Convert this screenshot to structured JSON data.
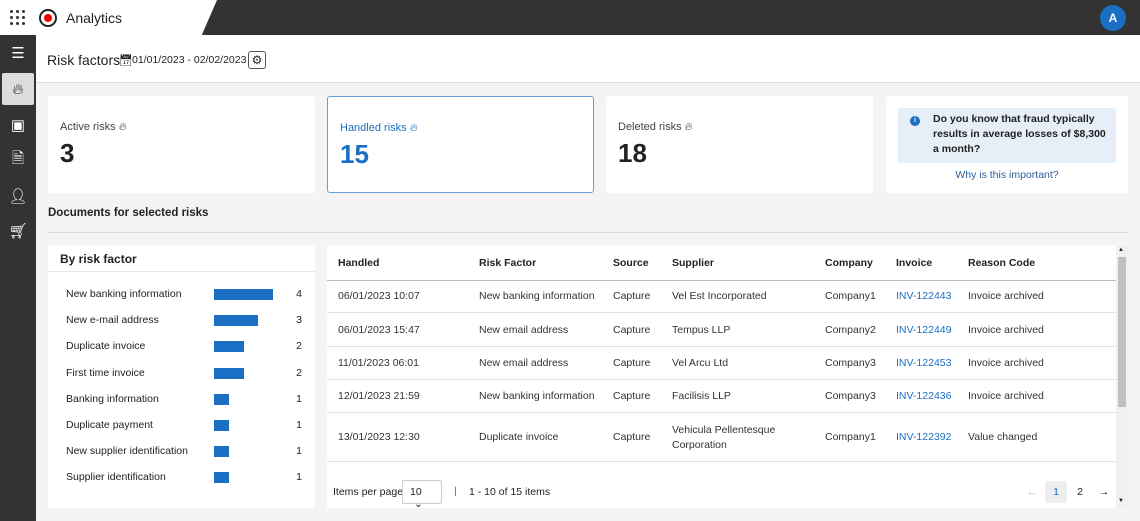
{
  "app": {
    "title": "Analytics",
    "avatar": "A"
  },
  "sidebar": {
    "items": [
      {
        "icon": "menu-icon"
      },
      {
        "icon": "flame-icon",
        "active": true
      },
      {
        "icon": "money-icon"
      },
      {
        "icon": "document-icon"
      },
      {
        "icon": "user-icon"
      },
      {
        "icon": "cart-icon"
      }
    ]
  },
  "header": {
    "title": "Risk factors",
    "date_range": "01/01/2023 - 02/02/2023"
  },
  "cards": [
    {
      "label": "Active risks",
      "value": "3"
    },
    {
      "label": "Handled risks",
      "value": "15"
    },
    {
      "label": "Deleted risks",
      "value": "18"
    }
  ],
  "info": {
    "text": "Do you know that fraud typically results in average losses of $8,300 a month?",
    "link": "Why is this important?"
  },
  "section_title": "Documents for selected risks",
  "by_risk": {
    "title": "By risk factor",
    "items": [
      {
        "name": "New banking information",
        "count": 4
      },
      {
        "name": "New e-mail address",
        "count": 3
      },
      {
        "name": "Duplicate invoice",
        "count": 2
      },
      {
        "name": "First time invoice",
        "count": 2
      },
      {
        "name": "Banking information",
        "count": 1
      },
      {
        "name": "Duplicate payment",
        "count": 1
      },
      {
        "name": "New supplier identification",
        "count": 1
      },
      {
        "name": "Supplier identification",
        "count": 1
      }
    ]
  },
  "table": {
    "columns": [
      "Handled",
      "Risk Factor",
      "Source",
      "Supplier",
      "Company",
      "Invoice",
      "Reason Code"
    ],
    "rows": [
      [
        "06/01/2023 10:07",
        "New banking information",
        "Capture",
        "Vel Est Incorporated",
        "Company1",
        "INV-122443",
        "Invoice archived"
      ],
      [
        "06/01/2023 15:47",
        "New email address",
        "Capture",
        "Tempus LLP",
        "Company2",
        "INV-122449",
        "Invoice archived"
      ],
      [
        "11/01/2023 06:01",
        "New email address",
        "Capture",
        "Vel Arcu Ltd",
        "Company3",
        "INV-122453",
        "Invoice archived"
      ],
      [
        "12/01/2023 21:59",
        "New banking information",
        "Capture",
        "Facilisis LLP",
        "Company3",
        "INV-122436",
        "Invoice archived"
      ],
      [
        "13/01/2023 12:30",
        "Duplicate invoice",
        "Capture",
        "Vehicula Pellentesque Corporation",
        "Company1",
        "INV-122392",
        "Value changed"
      ]
    ]
  },
  "pagination": {
    "items_per_page_label": "Items per page",
    "page_size": "10",
    "summary": "1 - 10 of 15 items",
    "pages": [
      "1",
      "2"
    ],
    "current": "1"
  },
  "colors": {
    "accent": "#1a6fc4",
    "topbar": "#333333"
  }
}
